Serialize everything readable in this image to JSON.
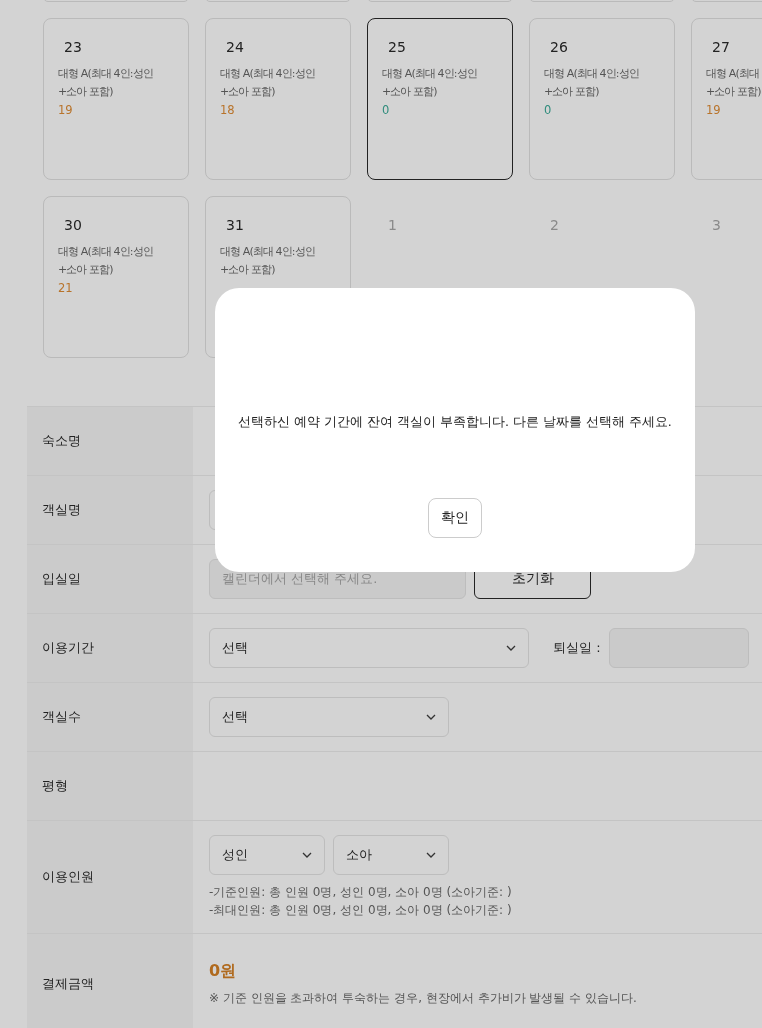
{
  "calendar": {
    "weeks": [
      {
        "days": [
          {
            "date": "23",
            "in_month": true,
            "selected": false,
            "room_lines": [
              "대형 A(최대 4인:성인",
              "+소아 포함)"
            ],
            "count": "19",
            "color": "#b8732a"
          },
          {
            "date": "24",
            "in_month": true,
            "selected": false,
            "room_lines": [
              "대형 A(최대 4인:성인",
              "+소아 포함)"
            ],
            "count": "18",
            "color": "#b8732a"
          },
          {
            "date": "25",
            "in_month": true,
            "selected": true,
            "room_lines": [
              "대형 A(최대 4인:성인",
              "+소아 포함)"
            ],
            "count": "0",
            "color": "#2f8c7c"
          },
          {
            "date": "26",
            "in_month": true,
            "selected": false,
            "room_lines": [
              "대형 A(최대 4인:성인",
              "+소아 포함)"
            ],
            "count": "0",
            "color": "#2f8c7c"
          },
          {
            "date": "27",
            "in_month": true,
            "selected": false,
            "room_lines": [
              "대형 A(최대",
              "+소아 포함)"
            ],
            "count": "19",
            "color": "#b8732a"
          }
        ]
      },
      {
        "days": [
          {
            "date": "30",
            "in_month": true,
            "selected": false,
            "room_lines": [
              "대형 A(최대 4인:성인",
              "+소아 포함)"
            ],
            "count": "21",
            "color": "#b8732a"
          },
          {
            "date": "31",
            "in_month": true,
            "selected": false,
            "room_lines": [
              "대형 A(최대 4인:성인",
              "+소아 포함)"
            ]
          },
          {
            "date": "1",
            "in_month": false
          },
          {
            "date": "2",
            "in_month": false
          },
          {
            "date": "3",
            "in_month": false
          }
        ]
      }
    ]
  },
  "form": {
    "rows": [
      {
        "label": "숙소명",
        "kind": "empty"
      },
      {
        "label": "객실명",
        "kind": "field"
      },
      {
        "label": "입실일",
        "kind": "date",
        "placeholder": "캘린더에서 선택해 주세요.",
        "button": "초기화"
      },
      {
        "label": "이용기간",
        "kind": "period",
        "select": "선택",
        "checkout_label": "퇴실일 :"
      },
      {
        "label": "객실수",
        "kind": "select",
        "select": "선택"
      },
      {
        "label": "평형",
        "kind": "empty"
      },
      {
        "label": "이용인원",
        "kind": "people",
        "selects": [
          "성인",
          "소아"
        ],
        "notes": [
          "-기준인원: 총 인원 0명, 성인 0명, 소아 0명 (소아기준: )",
          "-최대인원: 총 인원 0명, 성인 0명, 소아 0명 (소아기준: )"
        ]
      },
      {
        "label": "결제금액",
        "kind": "price",
        "price": "0원",
        "note": "※ 기준 인원을 초과하여 투숙하는 경우, 현장에서 추가비가 발생될 수 있습니다."
      }
    ]
  },
  "dialog": {
    "message": "선택하신 예약 기간에 잔여 객실이 부족합니다. 다른 날짜를 선택해 주세요.",
    "button": "확인"
  }
}
